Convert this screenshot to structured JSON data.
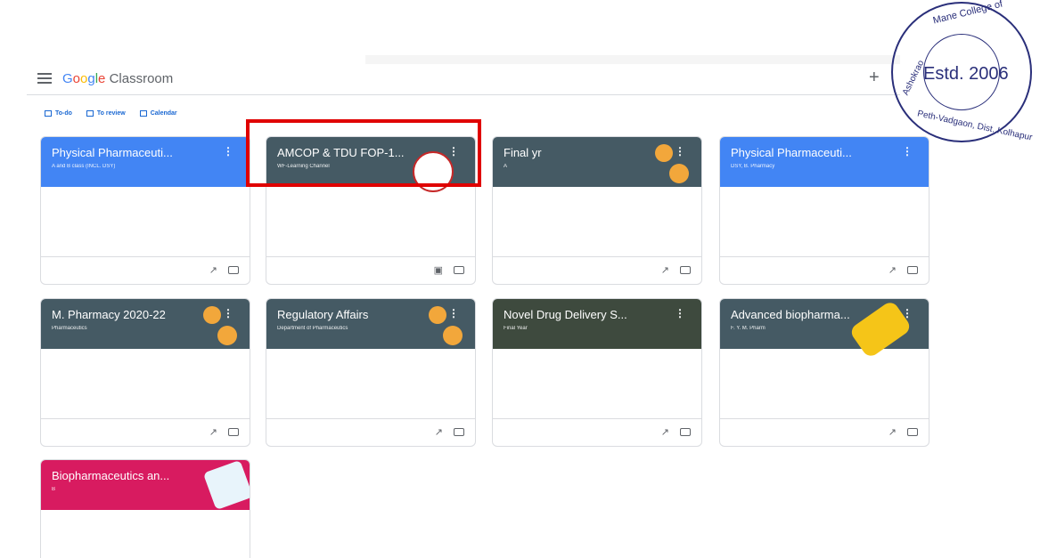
{
  "app": {
    "logo_google": "Google",
    "logo_classroom": "Classroom"
  },
  "subnav": {
    "todo": "To-do",
    "review": "To review",
    "calendar": "Calendar"
  },
  "header": {
    "add": "+"
  },
  "stamp": {
    "top": "Mane College of",
    "center": "Estd. 2006",
    "left": "Ashokrao",
    "bottom": "Peth-Vadgaon, Dist. Kolhapur"
  },
  "cards": [
    {
      "title": "Physical Pharmaceuti...",
      "sub": "A and B class (INCL. DSY)",
      "color": "#4285f4",
      "foot_icon": "trend-icon"
    },
    {
      "title": "AMCOP & TDU FOP-1...",
      "sub": "WF-Learning Channel",
      "color": "#455a64",
      "foot_icon": "assignment-icon"
    },
    {
      "title": "Final yr",
      "sub": "A",
      "color": "#455a64",
      "foot_icon": "trend-icon"
    },
    {
      "title": "Physical Pharmaceuti...",
      "sub": "DSY, B. Pharmacy",
      "color": "#4285f4",
      "foot_icon": "trend-icon"
    },
    {
      "title": "M. Pharmacy 2020-22",
      "sub": "Pharmaceutics",
      "color": "#455a64",
      "foot_icon": "trend-icon"
    },
    {
      "title": "Regulatory Affairs",
      "sub": "Department of Pharmaceutics",
      "color": "#455a64",
      "foot_icon": "trend-icon"
    },
    {
      "title": "Novel Drug Delivery S...",
      "sub": "Final Year",
      "color": "#3e4a3e",
      "foot_icon": "trend-icon"
    },
    {
      "title": "Advanced biopharma...",
      "sub": "F. Y. M. Pharm",
      "color": "#455a64",
      "foot_icon": "trend-icon"
    },
    {
      "title": "Biopharmaceutics an...",
      "sub": "B",
      "color": "#d81b60",
      "foot_icon": ""
    }
  ],
  "symbols": {
    "dots": "⋮",
    "trend": "↗",
    "assignment": "▣"
  }
}
